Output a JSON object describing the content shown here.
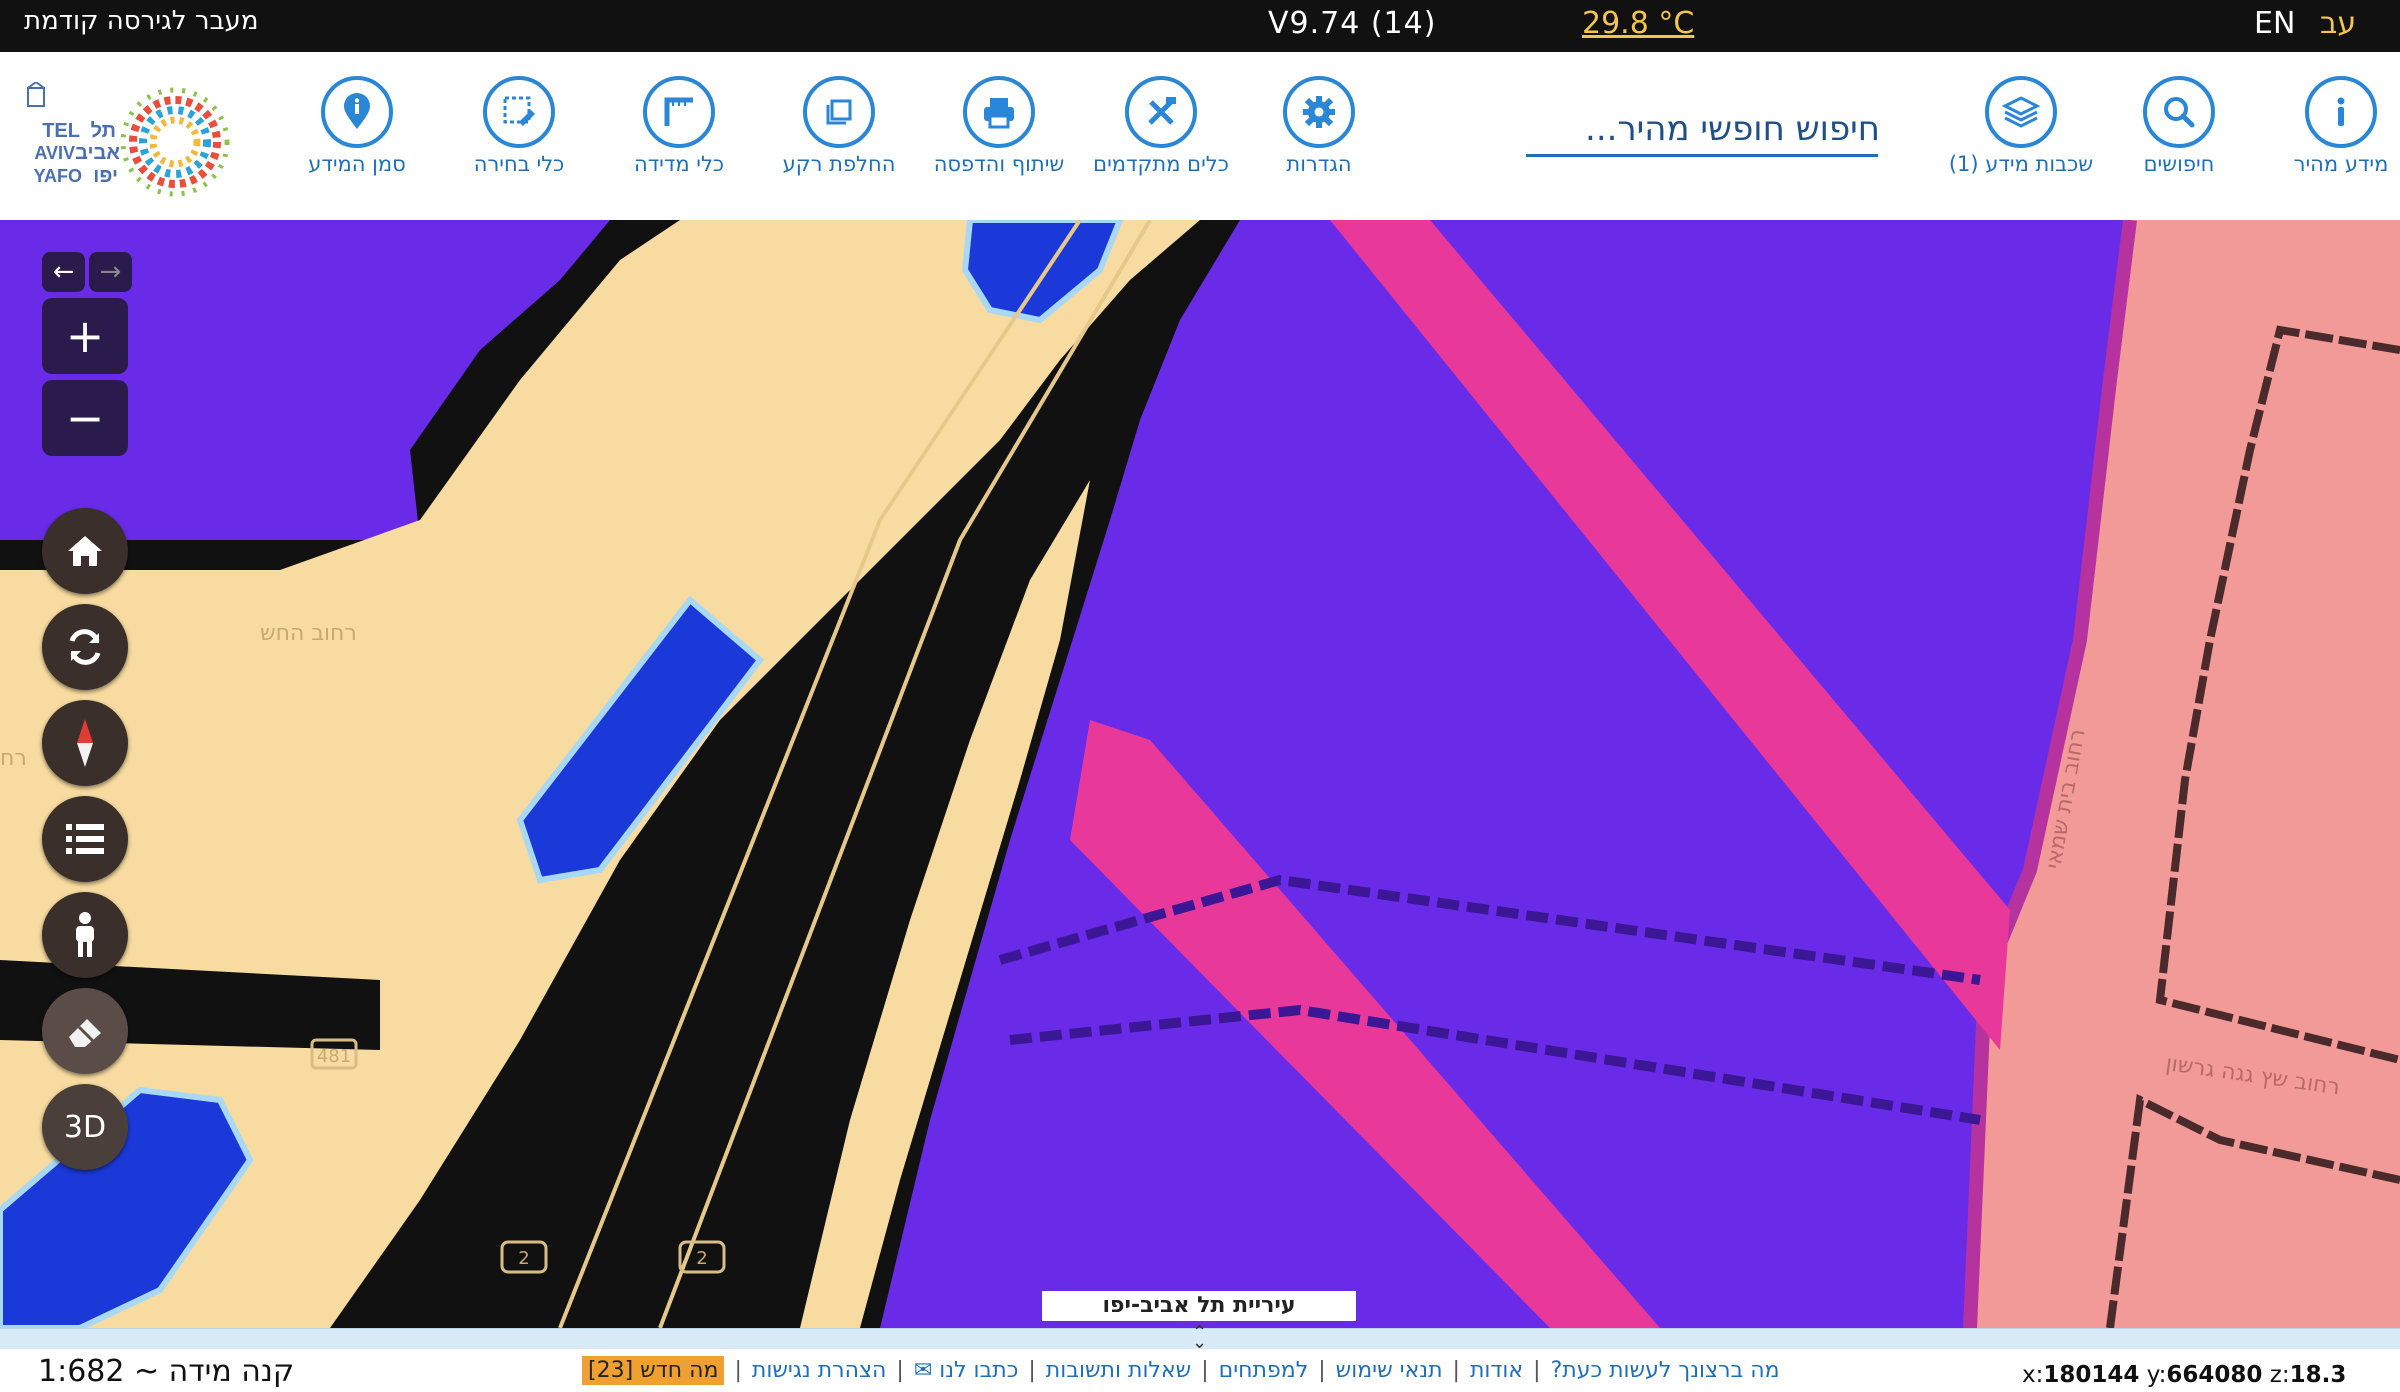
{
  "topbar": {
    "prev_version": "מעבר לגירסה קודמת",
    "version": "V9.74 (14)",
    "temperature": "29.8 °C",
    "lang_en": "EN",
    "lang_he": "עב"
  },
  "toolbar": {
    "tools": [
      {
        "label": "מידע מהיר",
        "icon": "info-icon"
      },
      {
        "label": "חיפושים",
        "icon": "magnifier-icon"
      },
      {
        "label": "שכבות מידע (1)",
        "icon": "layers-icon"
      },
      {
        "label": "הגדרות",
        "icon": "gear-icon"
      },
      {
        "label": "כלים מתקדמים",
        "icon": "tools-icon"
      },
      {
        "label": "שיתוף והדפסה",
        "icon": "printer-icon"
      },
      {
        "label": "החלפת רקע",
        "icon": "basemap-icon"
      },
      {
        "label": "כלי מדידה",
        "icon": "ruler-icon"
      },
      {
        "label": "כלי בחירה",
        "icon": "select-icon"
      },
      {
        "label": "סמן המידע",
        "icon": "pin-icon"
      }
    ],
    "search_placeholder": "חיפוש חופשי מהיר...",
    "logo_text": "תל אביב יפו TEL AVIV YAFO"
  },
  "map": {
    "label": "עיריית תל אביב-יפו",
    "zoom_in": "+",
    "zoom_out": "−",
    "back_arrow": "←",
    "forward_arrow": "→",
    "btn_3d": "3D",
    "road_numbers": [
      "481",
      "2",
      "2"
    ],
    "street_labels": [
      "רחוב החש",
      "רחוב בית שמאי",
      "רחוב שץ גגה גרשון",
      "רח"
    ]
  },
  "bottombar": {
    "scale": "קנה מידה ~ 1:682",
    "links": [
      "מה ברצונך לעשות כעת?",
      "אודות",
      "תנאי שימוש",
      "למפתחים",
      "שאלות ותשובות",
      "כתבו לנו ✉",
      "הצהרת נגישות"
    ],
    "whats_new": "מה חדש [23]",
    "coord_x_label": "x:",
    "coord_x": "180144",
    "coord_y_label": "y:",
    "coord_y": "664080",
    "coord_z_label": "z:",
    "coord_z": "18.3"
  },
  "colors": {
    "purple": "#6a2be8",
    "pink": "#e8389a",
    "sand": "#f7dba0",
    "blue": "#1b39d8",
    "salmon": "#f29a98",
    "accent": "#1e6fb8"
  }
}
